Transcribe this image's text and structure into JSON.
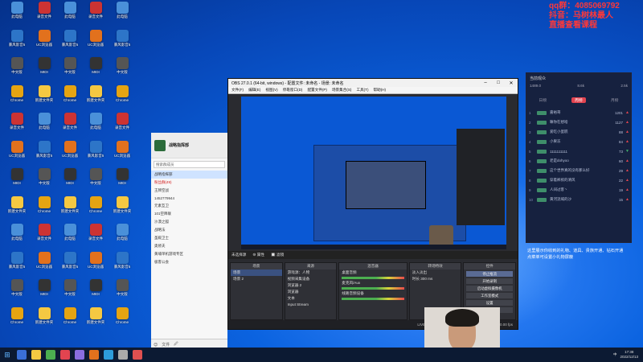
{
  "watermark": {
    "lines": [
      "qq群：4085069792",
      "抖音：马树林最人",
      "直播查看课程"
    ]
  },
  "desktop_icons": [
    {
      "label": "此电脑",
      "color": "#4a90d9"
    },
    {
      "label": "暴风影音5",
      "color": "#2d75c8"
    },
    {
      "label": "中文版",
      "color": "#555"
    },
    {
      "label": "Chrome",
      "color": "#e5a412"
    },
    {
      "label": "录音文件",
      "color": "#c33"
    },
    {
      "label": "UC浏览器",
      "color": "#e2711d"
    },
    {
      "label": "MIDI",
      "color": "#333"
    },
    {
      "label": "新建文件夹",
      "color": "#f5c842"
    }
  ],
  "chat": {
    "title": "战略指挥部",
    "id_label": "1452779",
    "search_placeholder": "搜索群成员",
    "members": [
      {
        "name": "战略指挥部",
        "cls": "sel"
      },
      {
        "name": "粉丝群(49)",
        "cls": "red"
      },
      {
        "name": "王牌空战",
        "cls": ""
      },
      {
        "name": "1452779944",
        "cls": ""
      },
      {
        "name": "元素互卫",
        "cls": ""
      },
      {
        "name": "101空降联",
        "cls": ""
      },
      {
        "name": "沙漠之狐",
        "cls": ""
      },
      {
        "name": "战略法",
        "cls": ""
      },
      {
        "name": "圣殿卫士",
        "cls": ""
      },
      {
        "name": "奥修夫",
        "cls": ""
      },
      {
        "name": "黄埔单机游戏专区",
        "cls": ""
      },
      {
        "name": "极客公会",
        "cls": ""
      }
    ],
    "bottom_bar": [
      "😊",
      "文件",
      "🖉"
    ]
  },
  "obs": {
    "title": "OBS 27.0.1 (64-bit, windows) - 配置文件: 未命名 - 场景: 未命名",
    "menu": [
      "文件(F)",
      "编辑(E)",
      "视图(V)",
      "停靠窗口(D)",
      "配置文件(P)",
      "场景集合(S)",
      "工具(T)",
      "帮助(H)"
    ],
    "status_row": [
      "未选择源",
      "⚙ 属性",
      "🔲 滤镜"
    ],
    "docks": {
      "scenes": {
        "header": "场景",
        "items": [
          "场景",
          "场景 2"
        ]
      },
      "sources": {
        "header": "来源",
        "items": [
          "游戏源：人物",
          "视频采集设备",
          "浏览器 2",
          "浏览器",
          "文本",
          "Input Stream"
        ]
      },
      "mixer": {
        "header": "混音器",
        "channels": [
          "桌面音频",
          "麦克风/Aux",
          "线路音频设备"
        ]
      },
      "transitions": {
        "header": "转场特效",
        "fade": "淡入淡出",
        "duration_label": "时长",
        "duration": "300 ms"
      },
      "controls": {
        "header": "控件",
        "buttons": [
          "停止推流",
          "开始录制",
          "启动虚拟摄像机",
          "工作室模式",
          "设置",
          "退出"
        ]
      }
    },
    "statusbar": [
      "LIVE: 00:00:00",
      "REC: 00:00:00",
      "CPU: 3.2%, 30.00 fps"
    ]
  },
  "rank": {
    "header": "当前观众",
    "stats": [
      "1489.0",
      "8.6k",
      "2.5k"
    ],
    "tabs": [
      "日榜",
      "周榜",
      "月榜"
    ],
    "active_tab": "周榜",
    "rows": [
      {
        "n": "1",
        "name": "嘉裕哥",
        "v": "1201",
        "t": "▲"
      },
      {
        "n": "2",
        "name": "嘛你在想啥",
        "v": "1127",
        "t": "▲"
      },
      {
        "n": "3",
        "name": "爱吃小蛋糕",
        "v": "88",
        "t": "▲"
      },
      {
        "n": "4",
        "name": "小果冻",
        "v": "84",
        "t": "▲"
      },
      {
        "n": "5",
        "name": "1111111111",
        "v": "73",
        "t": "▼"
      },
      {
        "n": "6",
        "name": "老是dohyoo",
        "v": "60",
        "t": "▲"
      },
      {
        "n": "7",
        "name": "这个世界真的没有那么好",
        "v": "29",
        "t": "▲"
      },
      {
        "n": "8",
        "name": "穿着裤衩的清风",
        "v": "22",
        "t": "▲"
      },
      {
        "n": "9",
        "name": "人间过客丶",
        "v": "19",
        "t": "▲"
      },
      {
        "n": "10",
        "name": "黄河流域的沙",
        "v": "15",
        "t": "▲"
      }
    ]
  },
  "notice": [
    "这里展示你收到的礼物、道具、贵族开通、钻石开通",
    "点菜单可设置小礼物屏蔽"
  ],
  "taskbar": {
    "clock_time": "17:38",
    "clock_date": "2022/12/13",
    "lang": "中",
    "icons": [
      "#3a6fd8",
      "#f5c842",
      "#4caf50",
      "#e24450",
      "#8a6de0",
      "#e2711d",
      "#2d9cdb",
      "#aaa",
      "#e05050"
    ]
  }
}
